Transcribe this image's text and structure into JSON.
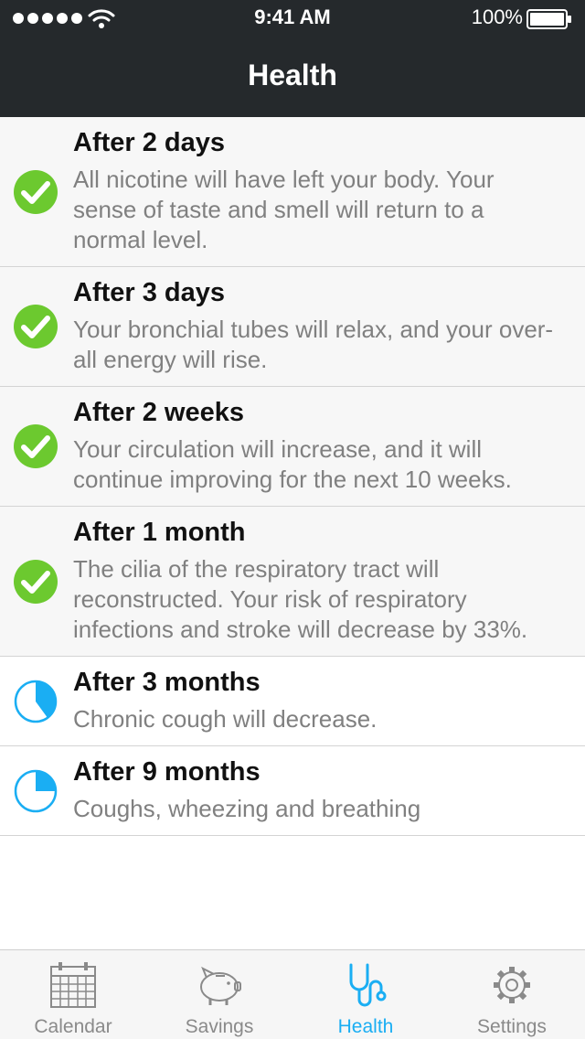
{
  "status_bar": {
    "time": "9:41 AM",
    "battery": "100%",
    "icons": [
      "signal-dots-icon",
      "wifi-icon",
      "battery-icon"
    ]
  },
  "nav": {
    "title": "Health"
  },
  "colors": {
    "header_bg": "#25292c",
    "check_green": "#6cc92f",
    "accent_blue": "#1aaef3",
    "done_row_bg": "#f7f7f7"
  },
  "milestones": [
    {
      "title": "After 2 days",
      "description": "All nicotine will have left your body. Your sense of taste and smell will return to a normal level.",
      "status": "done",
      "icon": "check-circle-icon"
    },
    {
      "title": "After 3 days",
      "description": "Your bronchial tubes will relax, and your over-all energy will rise.",
      "status": "done",
      "icon": "check-circle-icon"
    },
    {
      "title": "After 2 weeks",
      "description": "Your circulation will increase, and it will continue improving for the next 10 weeks.",
      "status": "done",
      "icon": "check-circle-icon"
    },
    {
      "title": "After 1 month",
      "description": "The cilia of the respiratory tract will reconstructed. Your risk of respiratory infections and stroke will decrease by 33%.",
      "status": "done",
      "icon": "check-circle-icon"
    },
    {
      "title": "After 3 months",
      "description": "Chronic cough will decrease.",
      "status": "in-progress",
      "progress": 0.4,
      "icon": "progress-pie-icon"
    },
    {
      "title": "After 9 months",
      "description": "Coughs, wheezing and breathing",
      "status": "in-progress",
      "progress": 0.25,
      "icon": "progress-pie-icon"
    }
  ],
  "tabs": [
    {
      "label": "Calendar",
      "icon": "calendar-icon",
      "active": false
    },
    {
      "label": "Savings",
      "icon": "piggy-bank-icon",
      "active": false
    },
    {
      "label": "Health",
      "icon": "stethoscope-icon",
      "active": true
    },
    {
      "label": "Settings",
      "icon": "gear-icon",
      "active": false
    }
  ]
}
